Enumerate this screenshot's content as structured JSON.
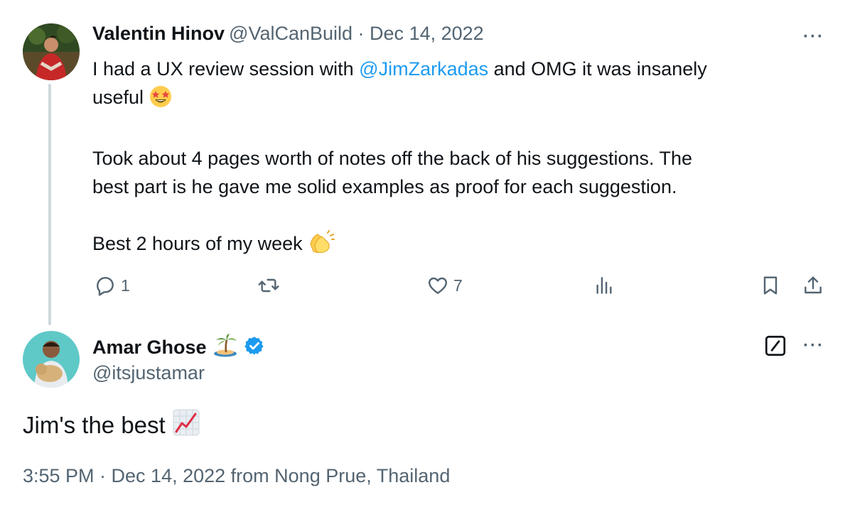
{
  "parent": {
    "author_name": "Valentin Hinov",
    "handle": "@ValCanBuild",
    "separator": " · ",
    "date": "Dec 14, 2022",
    "text_before_mention": "I had a UX review session with ",
    "mention": "@JimZarkadas",
    "text_after_mention": " and OMG it was insanely",
    "line2": "useful",
    "para2_line1": "Took about 4 pages worth of notes off the back of his suggestions. The",
    "para2_line2": "best part is he gave me solid examples as proof for each suggestion.",
    "para3": "Best 2 hours of my week",
    "emoji_1": "star-struck-emoji",
    "emoji_2": "clapping-hands-emoji",
    "actions": {
      "reply_count": "1",
      "retweet_count": "",
      "like_count": "7"
    }
  },
  "reply": {
    "author_name": "Amar Ghose",
    "author_emoji": "desert-island-emoji",
    "verified": true,
    "handle": "@itsjustamar",
    "text": "Jim's the best",
    "text_emoji": "chart-increasing-emoji",
    "timestamp": "3:55 PM · Dec 14, 2022 from Nong Prue, Thailand"
  },
  "more_label": "···",
  "colors": {
    "link": "#1d9bf0",
    "muted": "#536471",
    "text": "#0f1419",
    "thread_line": "#cfd9de",
    "verified": "#1d9bf0"
  }
}
